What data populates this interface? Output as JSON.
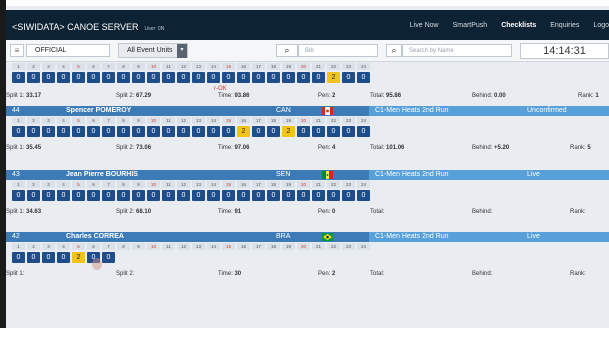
{
  "app": {
    "brand": "<SIWIDATA> CANOE SERVER",
    "user": "User: 0N",
    "nav": [
      "Live Now",
      "SmartPush",
      "Checklists",
      "Enquiries",
      "Logo"
    ],
    "active_nav": "Checklists"
  },
  "toolbar": {
    "official": "OFFICIAL",
    "units": "All Event Units",
    "bib_placeholder": "Bib",
    "name_placeholder": "Search by Name",
    "clock": "14:14:31"
  },
  "row0": {
    "penalties": [
      "0",
      "0",
      "0",
      "0",
      "0",
      "0",
      "0",
      "0",
      "0",
      "0",
      "0",
      "0",
      "0",
      "0",
      "0",
      "0",
      "0",
      "0",
      "0",
      "0",
      "0",
      "2",
      "0",
      "0"
    ],
    "rok": "r-OK",
    "split1_label": "Split 1:",
    "split1": "33.17",
    "split2_label": "Split 2:",
    "split2": "67.29",
    "time_label": "Time:",
    "time": "93.86",
    "pen_label": "Pen:",
    "pen": "2",
    "total_label": "Total:",
    "total": "95.86",
    "behind_label": "Behind:",
    "behind": "0.00",
    "rank_label": "Rank:",
    "rank": "1"
  },
  "athletes": [
    {
      "bib": "44",
      "name": "Spencer POMEROY",
      "nation": "CAN",
      "event": "C1-Men Heats 2nd Run",
      "status": "Unconfirmed",
      "penalties": [
        "0",
        "0",
        "0",
        "0",
        "0",
        "0",
        "0",
        "0",
        "0",
        "0",
        "0",
        "0",
        "0",
        "0",
        "0",
        "2",
        "0",
        "0",
        "2",
        "0",
        "0",
        "0",
        "0",
        "0"
      ],
      "split1_label": "Split 1:",
      "split1": "35.45",
      "split2_label": "Split 2:",
      "split2": "73.06",
      "time_label": "Time:",
      "time": "97.06",
      "pen_label": "Pen:",
      "pen": "4",
      "total_label": "Total:",
      "total": "101.06",
      "behind_label": "Behind:",
      "behind": "+5.20",
      "rank_label": "Rank:",
      "rank": "5"
    },
    {
      "bib": "43",
      "name": "Jean Pierre BOURHIS",
      "nation": "SEN",
      "event": "C1-Men Heats 2nd Run",
      "status": "Live",
      "penalties": [
        "0",
        "0",
        "0",
        "0",
        "0",
        "0",
        "0",
        "0",
        "0",
        "0",
        "0",
        "0",
        "0",
        "0",
        "0",
        "0",
        "0",
        "0",
        "0",
        "0",
        "0",
        "0",
        "0",
        "0"
      ],
      "split1_label": "Split 1:",
      "split1": "34.63",
      "split2_label": "Split 2:",
      "split2": "68.10",
      "time_label": "Time:",
      "time": "91",
      "pen_label": "Pen:",
      "pen": "0",
      "total_label": "Total:",
      "total": "",
      "behind_label": "Behind:",
      "behind": "",
      "rank_label": "Rank:",
      "rank": ""
    },
    {
      "bib": "42",
      "name": "Charles CORREA",
      "nation": "BRA",
      "event": "C1-Men Heats 2nd Run",
      "status": "Live",
      "penalties": [
        "0",
        "0",
        "0",
        "0",
        "2",
        "0",
        "0"
      ],
      "split1_label": "Split 1:",
      "split1": "",
      "split2_label": "Split 2:",
      "split2": "",
      "time_label": "Time:",
      "time": "30",
      "pen_label": "Pen:",
      "pen": "2",
      "total_label": "Total:",
      "total": "",
      "behind_label": "Behind:",
      "behind": "",
      "rank_label": "Rank:",
      "rank": ""
    }
  ],
  "gate_numbers": [
    "1",
    "2",
    "3",
    "4",
    "5",
    "6",
    "7",
    "8",
    "9",
    "10",
    "11",
    "12",
    "13",
    "14",
    "15",
    "16",
    "17",
    "18",
    "19",
    "20",
    "21",
    "22",
    "23",
    "24"
  ],
  "icons": {
    "toolbar": "list-icon",
    "search": "search-icon"
  },
  "colors": {
    "topbar": "#0d2233",
    "athlete_bar": "#3d7bb8",
    "event_bar": "#58a0d9",
    "penalty_zero": "#1e4d8a",
    "penalty_two": "#f3c21b"
  }
}
